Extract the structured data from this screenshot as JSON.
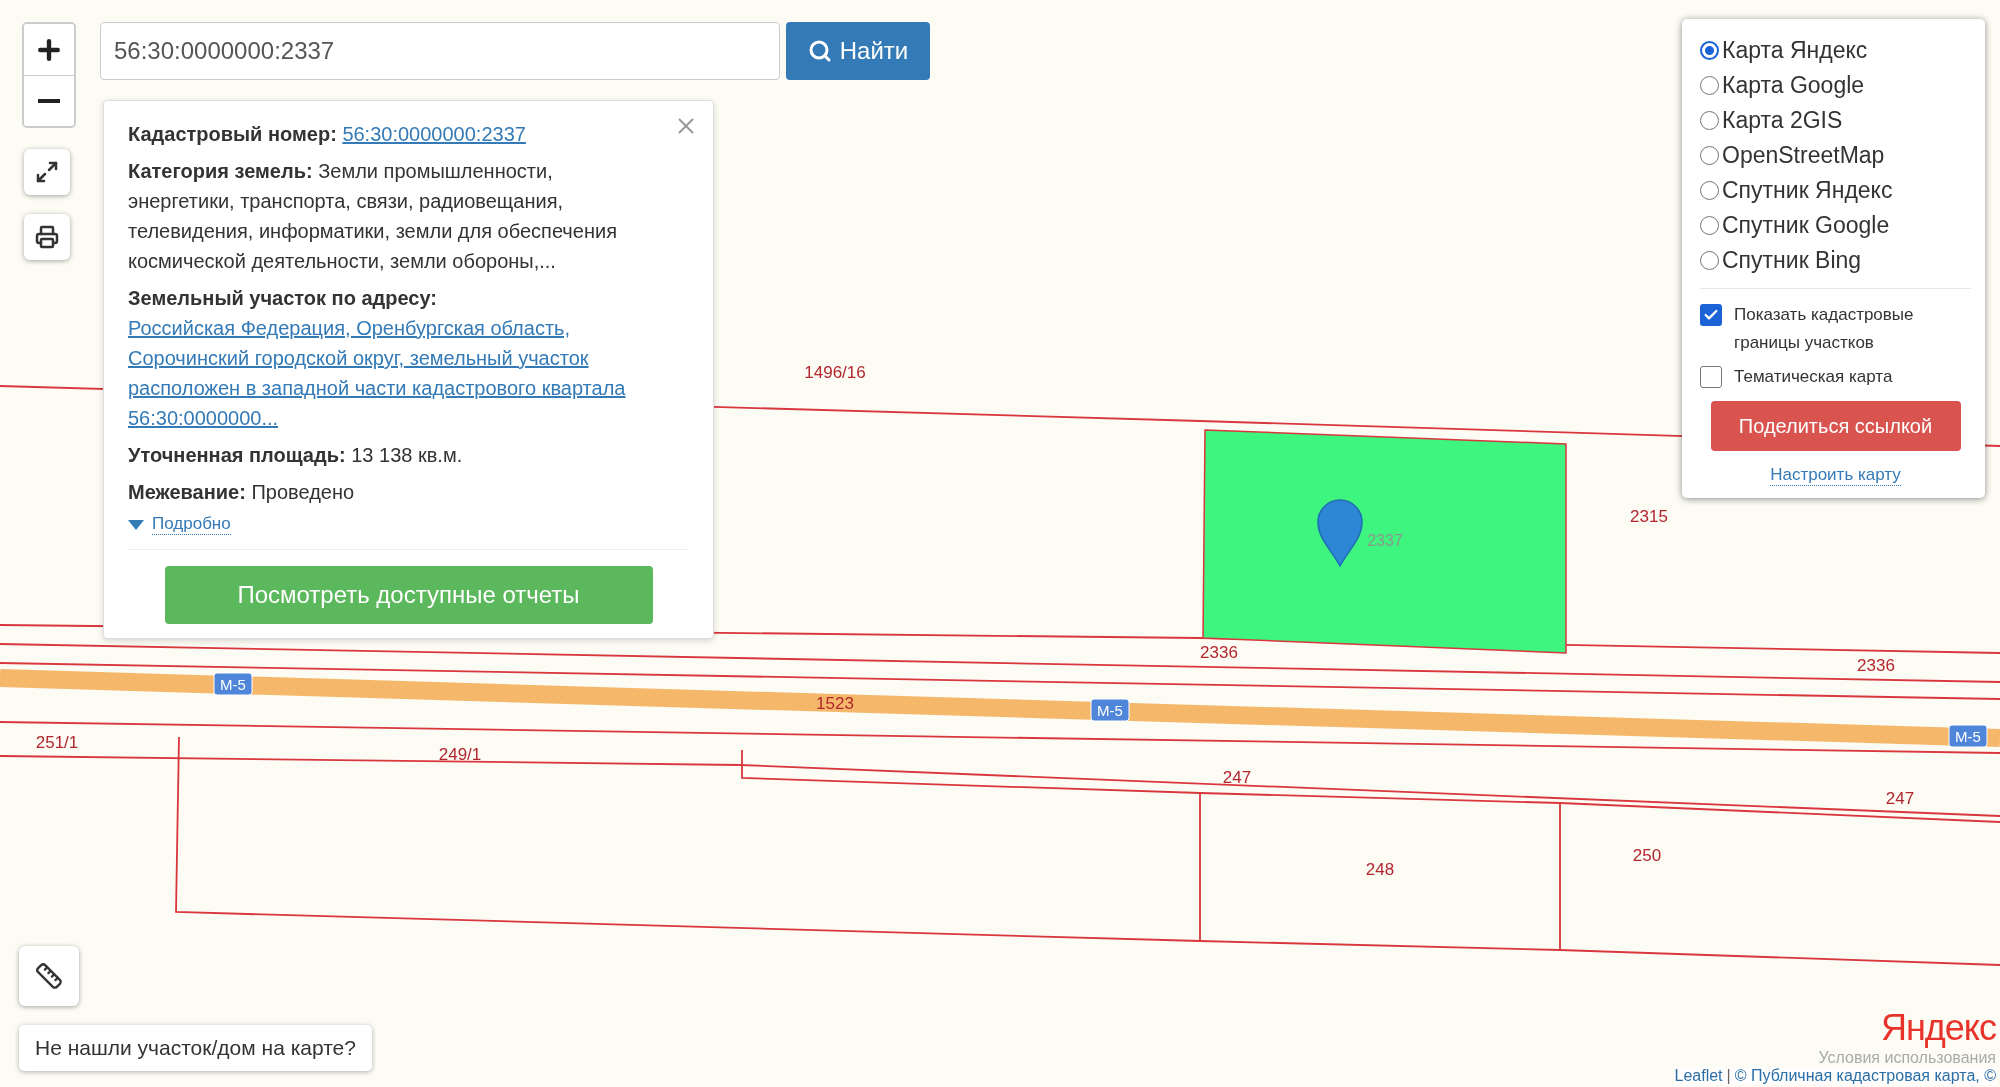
{
  "search": {
    "value": "56:30:0000000:2337",
    "button": "Найти"
  },
  "popup": {
    "fields": [
      {
        "label": "Кадастровый номер:",
        "value": "56:30:0000000:2337",
        "kind": "link"
      },
      {
        "label": "Категория земель:",
        "value": "Земли промышленности, энергетики, транспорта, связи, радиовещания, телевидения, информатики, земли для обеспечения космической деятельности, земли обороны,...",
        "kind": "text"
      },
      {
        "label": "Земельный участок по адресу:",
        "value": "Российская Федерация, Оренбургская область, Сорочинский городской округ, земельный участок расположен в западной части кадастрового квартала 56:30:0000000...",
        "kind": "link"
      },
      {
        "label": "Уточненная площадь:",
        "value": "13 138 кв.м.",
        "kind": "text"
      },
      {
        "label": "Межевание:",
        "value": "Проведено",
        "kind": "text"
      }
    ],
    "details": {
      "label": "Подробно",
      "expanded": false
    },
    "action": "Посмотреть доступные отчеты"
  },
  "layers": {
    "base": [
      {
        "label": "Карта Яндекс",
        "selected": true
      },
      {
        "label": "Карта Google",
        "selected": false
      },
      {
        "label": "Карта 2GIS",
        "selected": false
      },
      {
        "label": "OpenStreetMap",
        "selected": false
      },
      {
        "label": "Спутник Яндекс",
        "selected": false
      },
      {
        "label": "Спутник Google",
        "selected": false
      },
      {
        "label": "Спутник Bing",
        "selected": false
      }
    ],
    "overlays": [
      {
        "label": "Показать кадастровые границы участков",
        "checked": true
      },
      {
        "label": "Тематическая карта",
        "checked": false
      }
    ],
    "share": "Поделиться ссылкой",
    "settings": "Настроить карту"
  },
  "map": {
    "selected_parcel_label": "2337",
    "parcel_labels": [
      "1496/16",
      "2315",
      "2336",
      "2336",
      "1523",
      "251/1",
      "249/1",
      "247",
      "247",
      "248",
      "250"
    ],
    "road_badges": [
      "M-5",
      "M-5",
      "M-5"
    ]
  },
  "help_button": "Не нашли участок/дом на карте?",
  "attribution": {
    "logo": "Яндекс",
    "terms": "Условия использования",
    "leaflet": "Leaflet",
    "separator": "|",
    "source": "© Публичная кадастровая карта, ©"
  }
}
